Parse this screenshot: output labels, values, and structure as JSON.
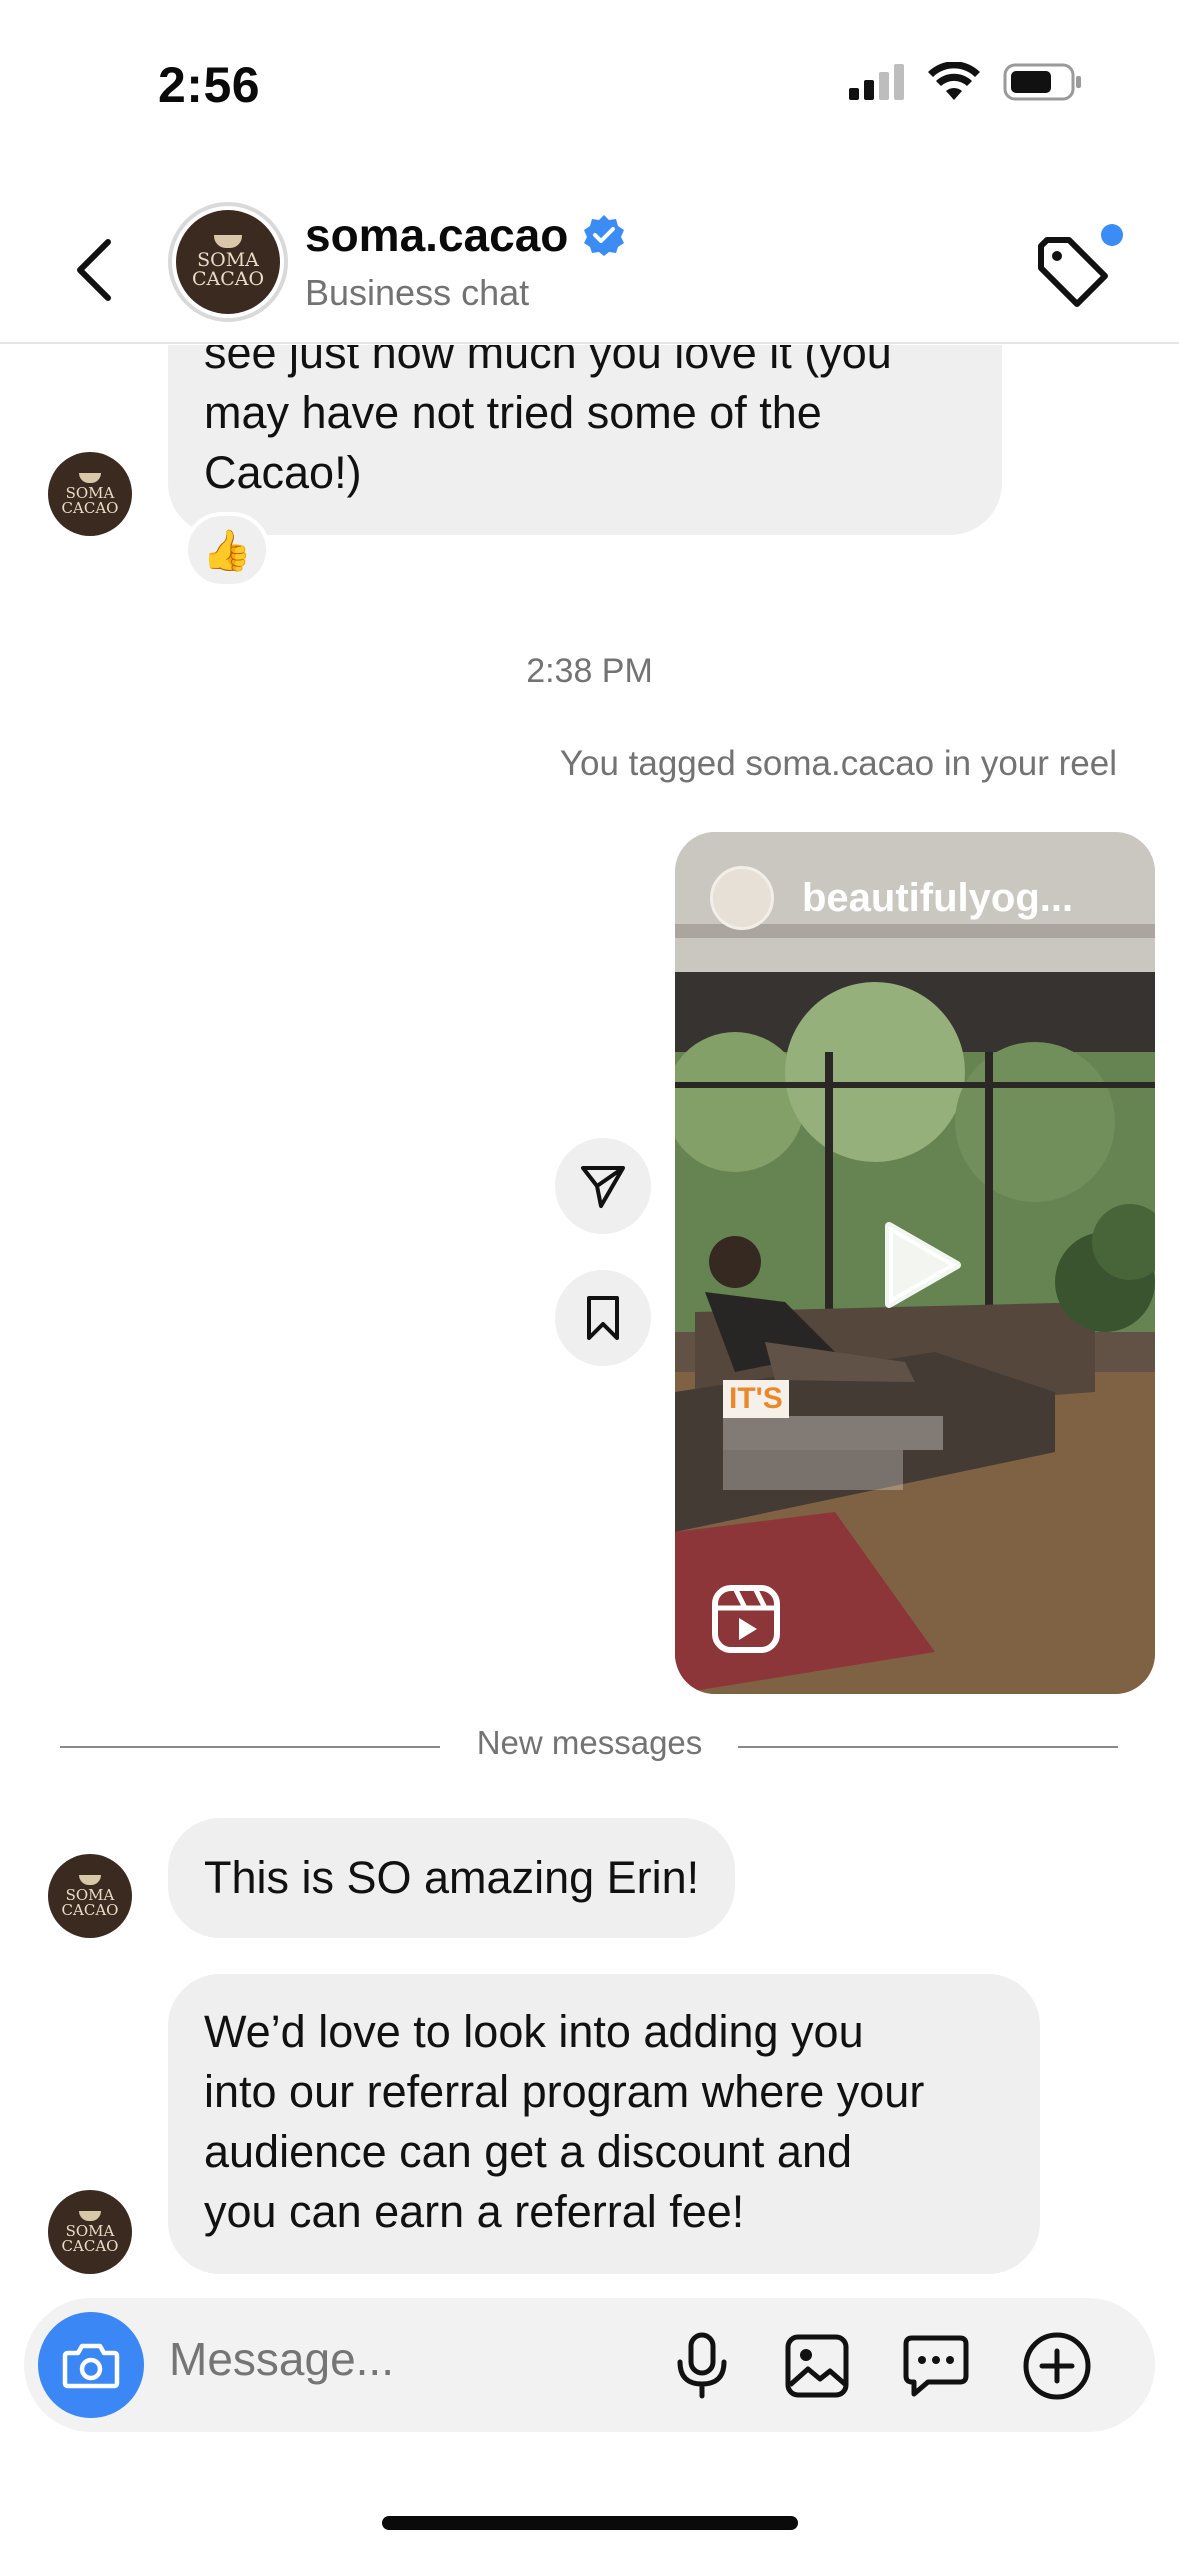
{
  "status_bar": {
    "time": "2:56"
  },
  "header": {
    "name": "soma.cacao",
    "subtitle": "Business chat",
    "avatar_text": [
      "SOMA",
      "CACAO"
    ],
    "verified_color": "#3b8cf5"
  },
  "messages": {
    "bubble1_lines": [
      "see just how much you love it (you",
      "may have not tried some of the",
      "Cacao!)"
    ],
    "reaction": "👍",
    "timestamp": "2:38 PM",
    "tag_note": "You tagged soma.cacao in your reel",
    "reel": {
      "author": "beautifulyog...",
      "overlay_text": "IT'S"
    },
    "divider": "New messages",
    "bubble2": "This is SO amazing Erin!",
    "bubble3_lines": [
      "We’d love to look into adding you",
      "into our referral program where your",
      "audience can get a discount and",
      "you can earn a referral fee!"
    ]
  },
  "composer": {
    "placeholder": "Message..."
  },
  "colors": {
    "accent": "#3a87f5",
    "bubble": "#efefef",
    "secondary_text": "#737373"
  }
}
